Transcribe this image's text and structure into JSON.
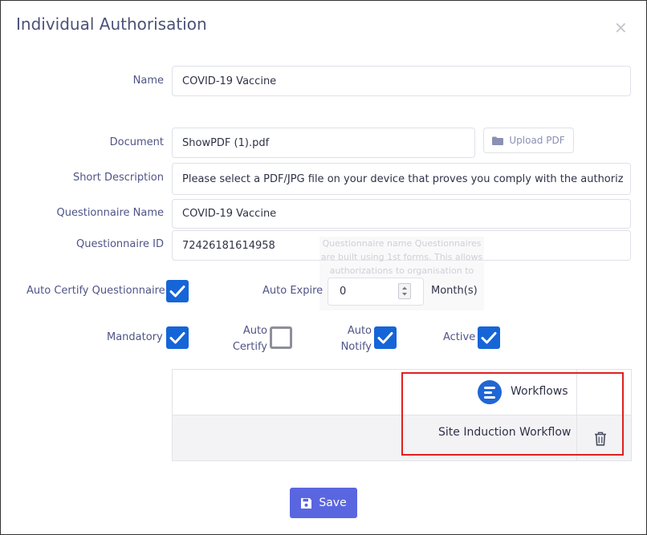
{
  "dialog": {
    "title": "Individual Authorisation",
    "close_glyph": "×"
  },
  "form": {
    "name": {
      "label": "Name",
      "value": "COVID-19 Vaccine"
    },
    "document": {
      "label": "Document",
      "value": "ShowPDF (1).pdf",
      "upload_label": "Upload PDF"
    },
    "short_description": {
      "label": "Short Description",
      "value": "Please select a PDF/JPG file on your device that proves you comply with the authoriz"
    },
    "questionnaire_name": {
      "label": "Questionnaire Name",
      "value": "COVID-19 Vaccine"
    },
    "questionnaire_id": {
      "label": "Questionnaire ID",
      "value": "72426181614958"
    },
    "tooltip_text": "Questionnaire name Questionnaires are built using 1st forms. This allows authorizations to organisation to respond",
    "auto_certify_questionnaire": {
      "label": "Auto Certify Questionnaire",
      "checked": true
    },
    "auto_expire": {
      "label": "Auto Expire",
      "value": "0",
      "unit": "Month(s)"
    },
    "mandatory": {
      "label": "Mandatory",
      "checked": true
    },
    "auto_certify": {
      "label_line1": "Auto",
      "label_line2": "Certify",
      "checked": false
    },
    "auto_notify": {
      "label_line1": "Auto",
      "label_line2": "Notify",
      "checked": true
    },
    "active": {
      "label": "Active",
      "checked": true
    }
  },
  "workflows": {
    "header": "Workflows",
    "rows": [
      {
        "name": "Site Induction Workflow"
      }
    ]
  },
  "actions": {
    "save_label": "Save"
  },
  "colors": {
    "accent": "#5a66e0",
    "checkbox": "#1565d8",
    "highlight": "#e02020",
    "label": "#4f5487"
  }
}
